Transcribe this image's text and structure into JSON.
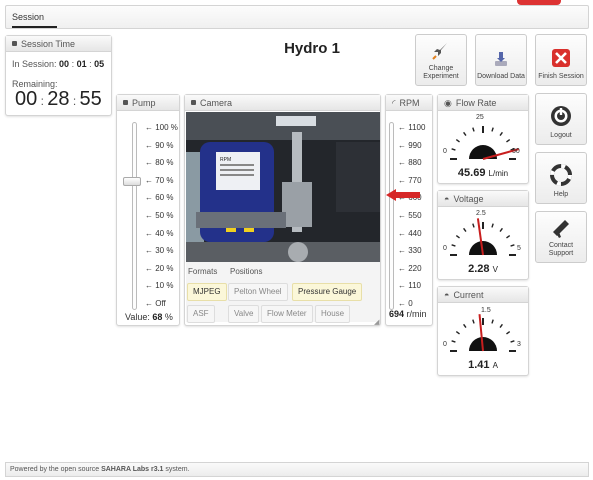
{
  "topbar": {
    "tab_label": "Session"
  },
  "page_title": "Hydro 1",
  "session_time": {
    "heading": "Session Time",
    "in_session_label": "In Session:",
    "in_session_h": "00",
    "in_session_m": "01",
    "in_session_s": "05",
    "remaining_label": "Remaining:",
    "remaining_h": "00",
    "remaining_m": "28",
    "remaining_s": "55"
  },
  "toolbar": {
    "change_experiment": "Change Experiment",
    "download_data": "Download Data",
    "finish_session": "Finish Session",
    "logout": "Logout",
    "help": "Help",
    "contact_support": "Contact Support"
  },
  "pump": {
    "heading": "Pump",
    "ticks": [
      "100 %",
      "90 %",
      "80 %",
      "70 %",
      "60 %",
      "50 %",
      "40 %",
      "30 %",
      "20 %",
      "10 %",
      "Off"
    ],
    "value_label": "Value:",
    "value": "68",
    "unit": "%",
    "level_fraction": 0.68
  },
  "camera": {
    "heading": "Camera",
    "formats_label": "Formats",
    "positions_label": "Positions",
    "formats": [
      {
        "label": "MJPEG",
        "active": true
      },
      {
        "label": "ASF",
        "active": false
      }
    ],
    "positions": [
      {
        "label": "Pelton Wheel",
        "active": false
      },
      {
        "label": "Pressure Gauge",
        "active": true
      },
      {
        "label": "Valve",
        "active": false
      },
      {
        "label": "Flow Meter",
        "active": false
      },
      {
        "label": "House",
        "active": false
      }
    ],
    "feed_text": "RPM"
  },
  "rpm": {
    "heading": "RPM",
    "ticks": [
      "1100",
      "990",
      "880",
      "770",
      "660",
      "550",
      "440",
      "330",
      "220",
      "110",
      "0"
    ],
    "value": "694",
    "unit": "r/min",
    "max": 1100
  },
  "flow_rate": {
    "heading": "Flow Rate",
    "min": "0",
    "mid": "25",
    "max": "50",
    "value": "45.69",
    "unit": "L/min",
    "fraction": 0.9138
  },
  "voltage": {
    "heading": "Voltage",
    "min": "0",
    "mid": "2.5",
    "max": "5",
    "value": "2.28",
    "unit": "V",
    "fraction": 0.456
  },
  "current": {
    "heading": "Current",
    "min": "0",
    "mid": "1.5",
    "max": "3",
    "value": "1.41",
    "unit": "A",
    "fraction": 0.47
  },
  "footer": {
    "prefix": "Powered by the open source ",
    "brand": "SAHARA Labs r3.1",
    "suffix": " system."
  },
  "colors": {
    "needle": "#c81e1e",
    "arrow": "#d62828",
    "finish_red": "#d9302c"
  }
}
